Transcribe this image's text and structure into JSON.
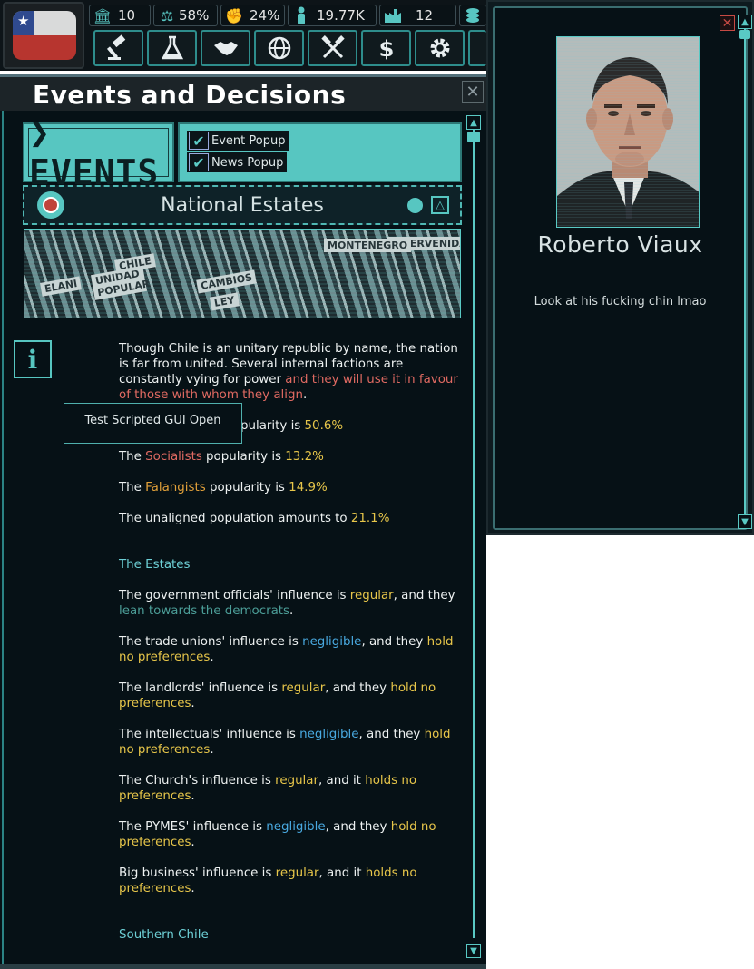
{
  "topbar": {
    "stats": [
      {
        "icon": "building-icon",
        "value": "10"
      },
      {
        "icon": "scales-icon",
        "value": "58%"
      },
      {
        "icon": "fist-icon",
        "value": "24%"
      },
      {
        "icon": "person-icon",
        "value": "19.77K"
      },
      {
        "icon": "factory-icon",
        "value": "12"
      },
      {
        "icon": "coins-icon",
        "value": ""
      }
    ],
    "buttons": [
      "gavel-icon",
      "flask-icon",
      "handshake-icon",
      "globe-icon",
      "hammers-icon",
      "dollar-icon",
      "gear-icon"
    ]
  },
  "events_panel": {
    "title": "Events and Decisions",
    "close_glyph": "✕",
    "events_tab_label": "❯EVENTS",
    "options": [
      {
        "label": "Event Popup",
        "checked": true
      },
      {
        "label": "News Popup",
        "checked": true
      }
    ],
    "estates_title": "National Estates",
    "banner_signs": [
      "UNIDAD POPULAR",
      "CHILE",
      "CAMBIOS",
      "ELANI",
      "LEY",
      "INTERVENIDA",
      "MONTENEGRO"
    ],
    "tooltip": "Test Scripted GUI Open",
    "intro": {
      "t1": "Though Chile is an unitary republic by name, the nation is far from united. Several internal factions are constantly vying for power ",
      "t2": "and they will use it in favour of those with whom they align",
      "t3": "."
    },
    "popularity": [
      {
        "pre": "The ",
        "party": "",
        "mid": "popularity is ",
        "value": "50.6%",
        "partycolor": ""
      },
      {
        "pre": "The ",
        "party": "Socialists",
        "mid": " popularity is ",
        "value": "13.2%",
        "partycolor": "red"
      },
      {
        "pre": "The ",
        "party": "Falangists",
        "mid": " popularity is ",
        "value": "14.9%",
        "partycolor": "orange"
      }
    ],
    "popularity_first_visible": "pularity is ",
    "unaligned": {
      "text": "The unaligned population amounts to ",
      "value": "21.1%"
    },
    "estates_heading": "The Estates",
    "estates": [
      {
        "a": "The government officials' influence is ",
        "inf": "regular",
        "infc": "yel",
        "b": ", and they ",
        "pref": "lean towards the democrats",
        "prefc": "tealdim",
        "c": "."
      },
      {
        "a": "The trade unions' influence is ",
        "inf": "negligible",
        "infc": "blu",
        "b": ", and they ",
        "pref": "hold no preferences",
        "prefc": "yel",
        "c": "."
      },
      {
        "a": "The landlords' influence is ",
        "inf": "regular",
        "infc": "yel",
        "b": ", and they ",
        "pref": "hold no preferences",
        "prefc": "yel",
        "c": "."
      },
      {
        "a": "The intellectuals' influence is ",
        "inf": "negligible",
        "infc": "blu",
        "b": ", and they ",
        "pref": "hold no preferences",
        "prefc": "yel",
        "c": "."
      },
      {
        "a": "The Church's influence is ",
        "inf": "regular",
        "infc": "yel",
        "b": ", and it ",
        "pref": "holds no preferences",
        "prefc": "yel",
        "c": "."
      },
      {
        "a": "The PYMES' influence is ",
        "inf": "negligible",
        "infc": "blu",
        "b": ", and they ",
        "pref": "hold no preferences",
        "prefc": "yel",
        "c": "."
      },
      {
        "a": "Big business' influence is ",
        "inf": "regular",
        "infc": "yel",
        "b": ", and it ",
        "pref": "holds no preferences",
        "prefc": "yel",
        "c": "."
      }
    ],
    "southern_heading": "Southern Chile"
  },
  "character_panel": {
    "close_glyph": "✕",
    "name": "Roberto Viaux",
    "description": "Look at his fucking chin lmao"
  },
  "colors": {
    "accent": "#57c6c1",
    "panel_bg": "#061116",
    "red": "#e06a62",
    "yellow": "#e7c64a",
    "blue": "#49a9e0"
  }
}
